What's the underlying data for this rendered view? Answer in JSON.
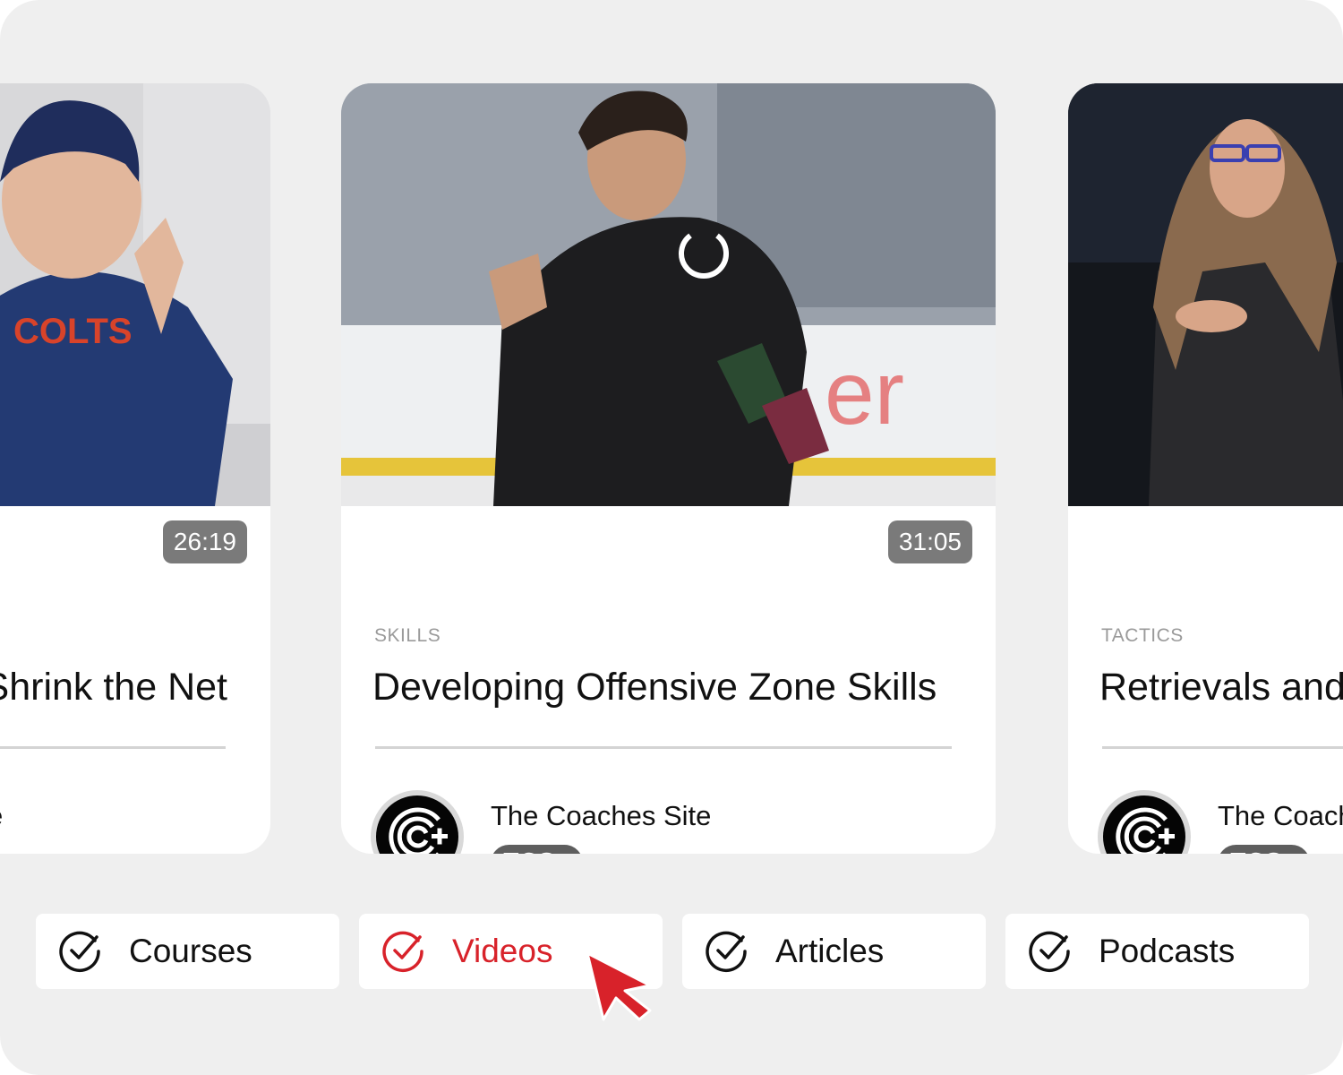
{
  "cards": [
    {
      "duration": "26:19",
      "category": "",
      "title": "Shrink the Net",
      "author_fragment": "e"
    },
    {
      "duration": "31:05",
      "category": "SKILLS",
      "title": "Developing Offensive Zone Skills",
      "author": "The Coaches Site",
      "badge": "TCS+"
    },
    {
      "duration": "",
      "category": "TACTICS",
      "title": "Retrievals and",
      "author": "The Coach",
      "badge": "TCS+"
    }
  ],
  "filters": [
    {
      "label": "Courses",
      "active": false
    },
    {
      "label": "Videos",
      "active": true
    },
    {
      "label": "Articles",
      "active": false
    },
    {
      "label": "Podcasts",
      "active": false
    }
  ],
  "colors": {
    "accent": "#d8222a",
    "background": "#efefef",
    "card": "#ffffff",
    "badge": "#5e5e5e"
  },
  "icons": {
    "filter_check": "check-circle-icon",
    "logo": "coaches-site-logo-icon",
    "pointer": "mouse-pointer-icon"
  }
}
